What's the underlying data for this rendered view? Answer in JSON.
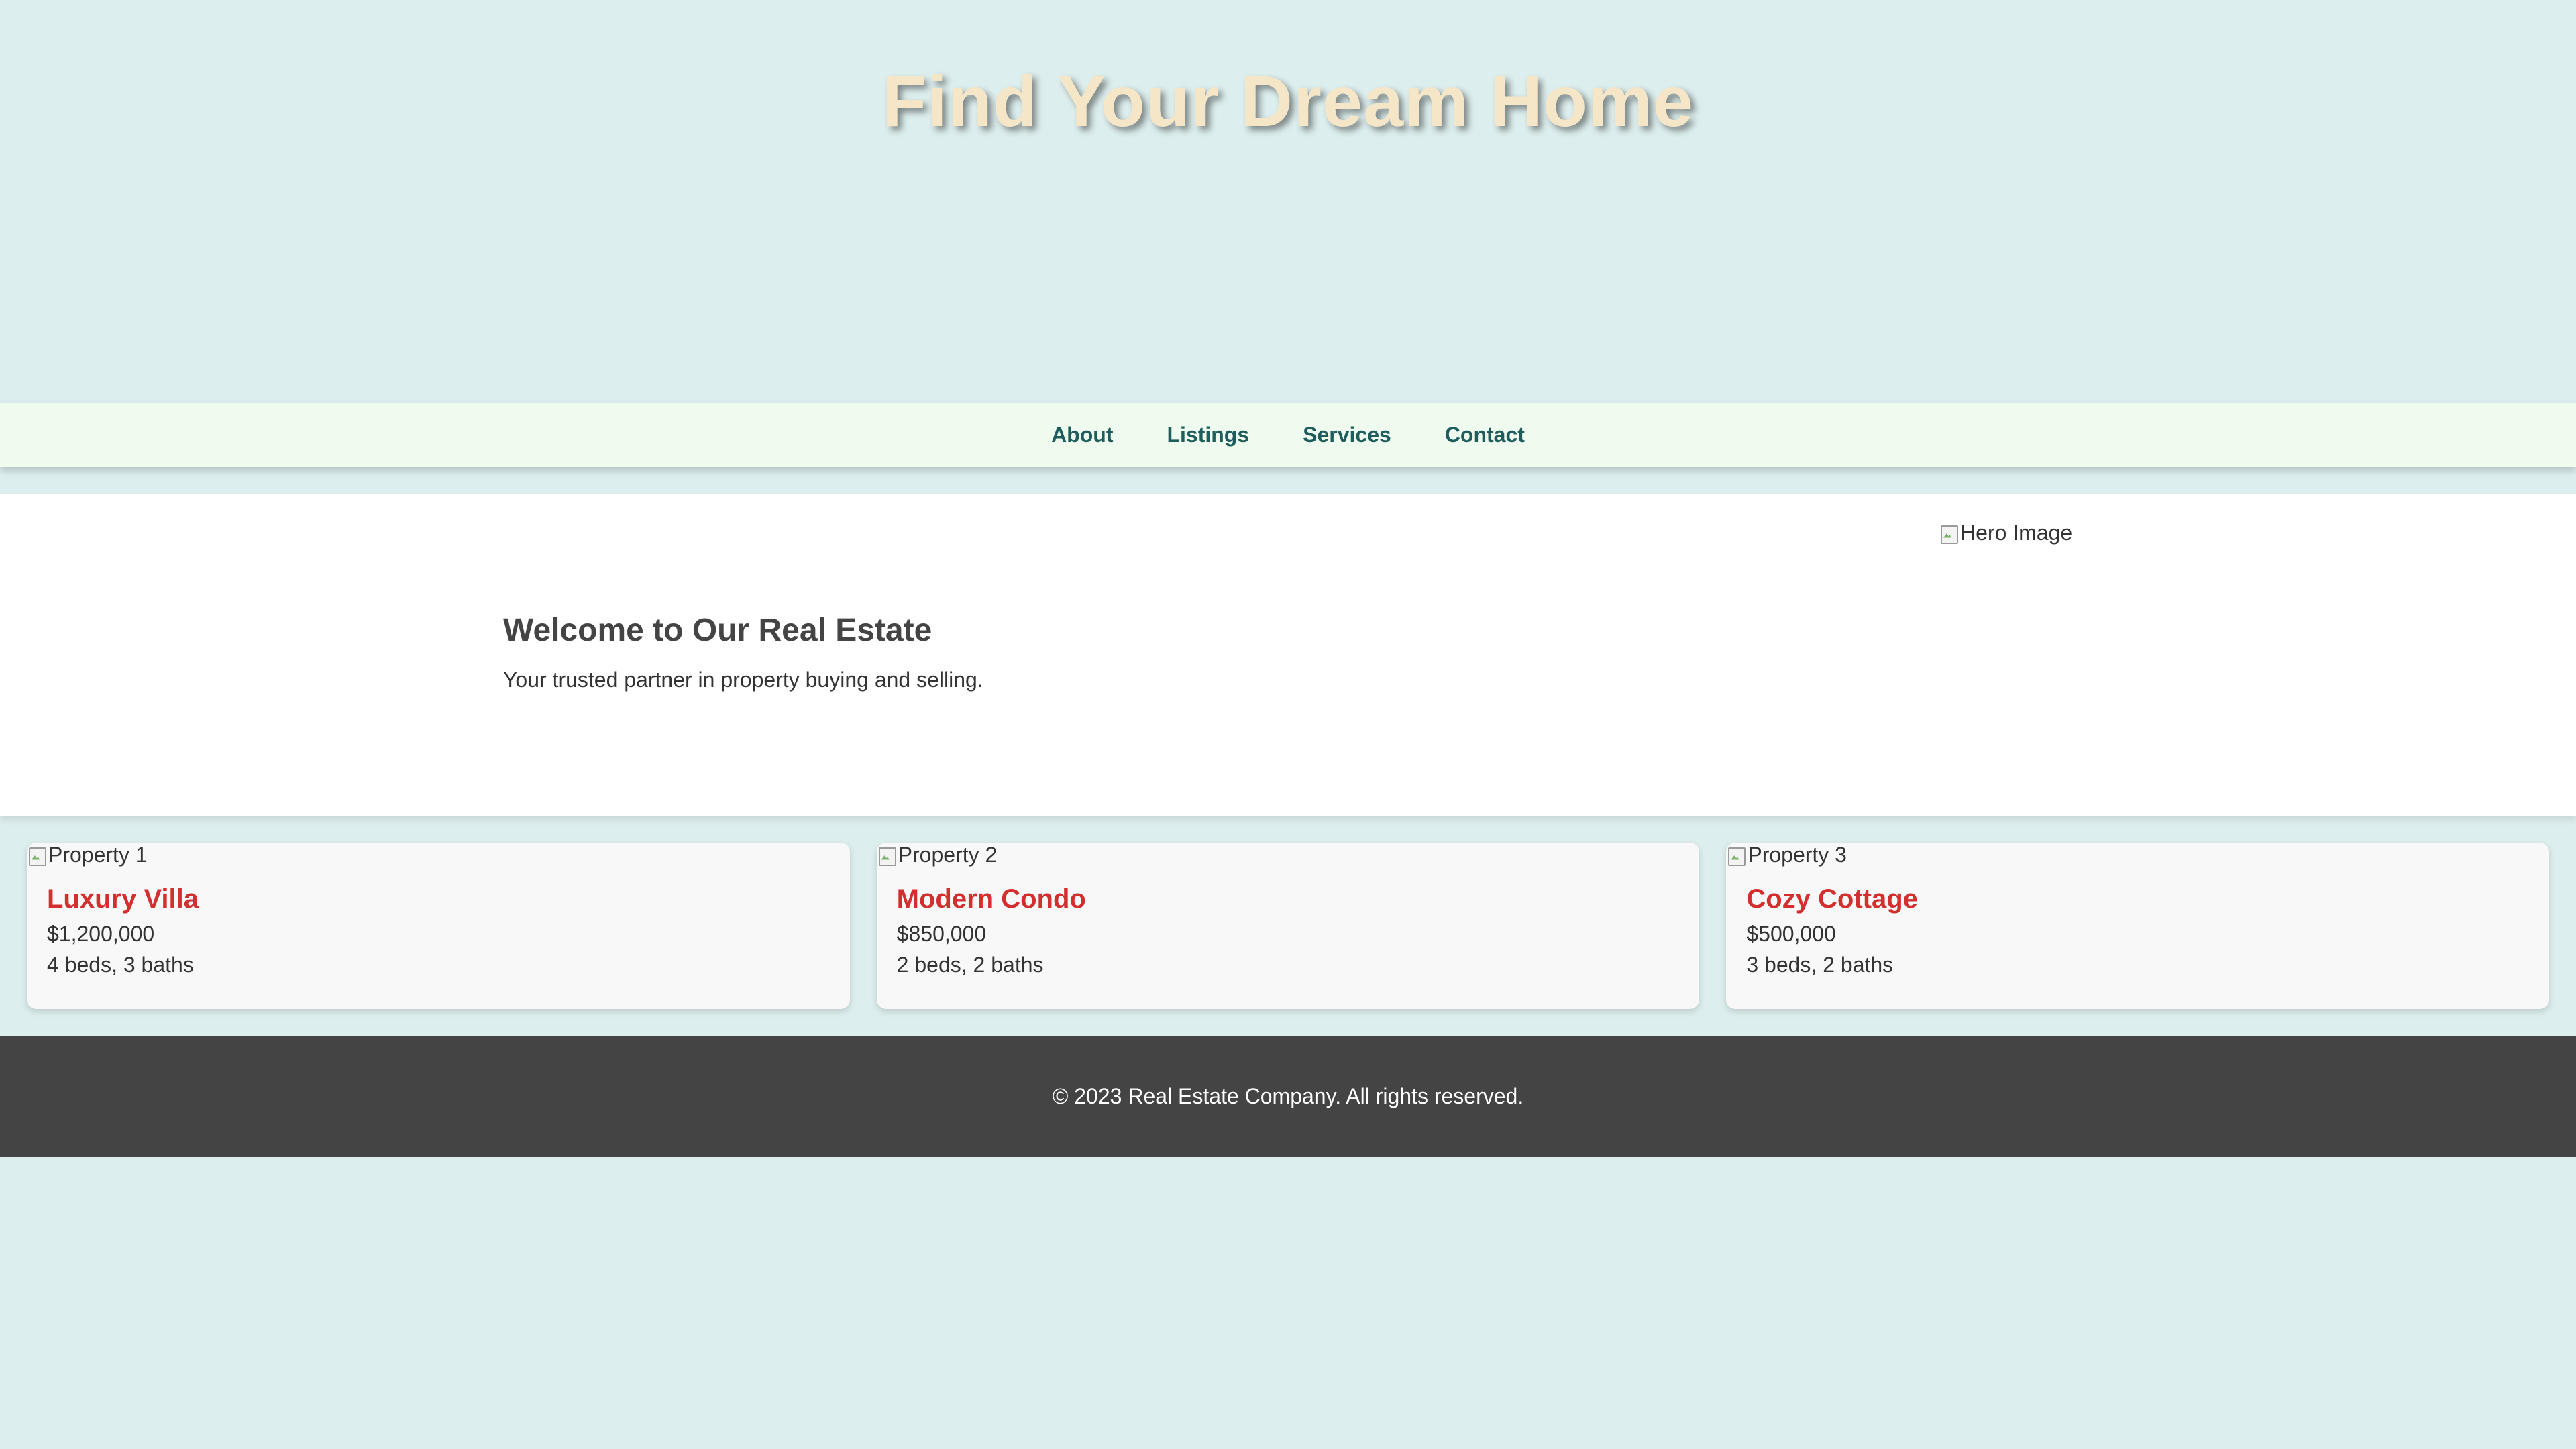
{
  "header": {
    "title": "Find Your Dream Home"
  },
  "nav": {
    "items": [
      {
        "label": "About"
      },
      {
        "label": "Listings"
      },
      {
        "label": "Services"
      },
      {
        "label": "Contact"
      }
    ]
  },
  "welcome": {
    "heading": "Welcome to Our Real Estate",
    "tagline": "Your trusted partner in property buying and selling.",
    "hero_image_alt": "Hero Image"
  },
  "properties": [
    {
      "image_alt": "Property 1",
      "name": "Luxury Villa",
      "price": "$1,200,000",
      "details": "4 beds, 3 baths"
    },
    {
      "image_alt": "Property 2",
      "name": "Modern Condo",
      "price": "$850,000",
      "details": "2 beds, 2 baths"
    },
    {
      "image_alt": "Property 3",
      "name": "Cozy Cottage",
      "price": "$500,000",
      "details": "3 beds, 2 baths"
    }
  ],
  "footer": {
    "text": "© 2023 Real Estate Company. All rights reserved."
  },
  "colors": {
    "page_background": "#ddeeee",
    "title": "#f5e6c8",
    "nav_background": "#f0fbf0",
    "nav_link": "#1f5c5c",
    "property_name": "#d32f2f",
    "footer_background": "#444444"
  },
  "icons": {
    "broken_image": "broken-image-icon"
  }
}
